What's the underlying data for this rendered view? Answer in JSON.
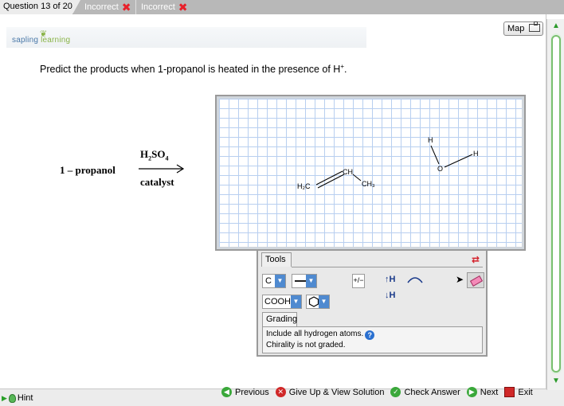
{
  "tabs": {
    "current": "Question 13 of 20",
    "attempts": [
      "Incorrect",
      "Incorrect"
    ]
  },
  "logo": {
    "part1": "sapling",
    "part2": "learning"
  },
  "map": {
    "label": "Map"
  },
  "question": {
    "text": "Predict the products when 1-propanol is heated in the presence of H",
    "superscript": "+",
    "end": "."
  },
  "reaction": {
    "reactant": "1 – propanol",
    "reagent_h": "H",
    "reagent_h_sub": "2",
    "reagent_so": "SO",
    "reagent_so_sub": "4",
    "condition": "catalyst"
  },
  "canvas": {
    "atoms": {
      "h2c": "H₂C",
      "ch": "CH",
      "ch3": "CH₃",
      "o": "O",
      "h_top": "H",
      "h_right": "H"
    }
  },
  "tools": {
    "tab": "Tools",
    "atom": "C",
    "group": "COOH",
    "charge": "+/−",
    "h_add": "↑H",
    "h_remove": "↓H",
    "grading_tab": "Grading",
    "grading_line1": "Include all hydrogen atoms.",
    "grading_line2": "Chirality is not graded."
  },
  "footer": {
    "hint": "Hint",
    "previous": "Previous",
    "give_up": "Give Up & View Solution",
    "check": "Check Answer",
    "next": "Next",
    "exit": "Exit"
  },
  "colors": {
    "incorrect": "#e8202a",
    "grid": "#b8cff0",
    "accent_green": "#3aa83a",
    "accent_blue": "#4f8ad0"
  }
}
